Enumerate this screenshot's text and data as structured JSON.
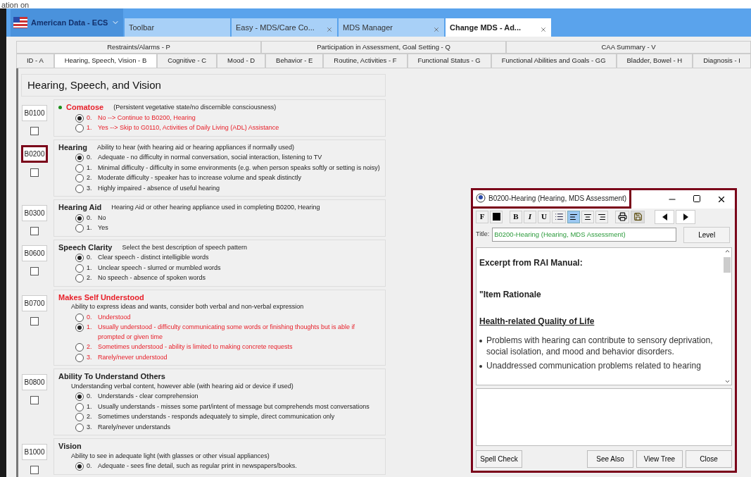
{
  "doc_fragment": "ation on",
  "app": {
    "name": "American Data - ECS"
  },
  "tabs": [
    {
      "label": "Toolbar",
      "closable": false,
      "selected": false
    },
    {
      "label": "Easy - MDS/Care Co...",
      "closable": true,
      "selected": false
    },
    {
      "label": "MDS Manager",
      "closable": true,
      "selected": false
    },
    {
      "label": "Change MDS - Ad...",
      "closable": true,
      "selected": true
    }
  ],
  "section_tabs_top": [
    "Restraints/Alarms - P",
    "Participation in Assessment, Goal Setting - Q",
    "CAA Summary - V"
  ],
  "section_tabs": [
    {
      "label": "ID - A",
      "selected": false
    },
    {
      "label": "Hearing, Speech, Vision - B",
      "selected": true
    },
    {
      "label": "Cognitive - C",
      "selected": false
    },
    {
      "label": "Mood - D",
      "selected": false
    },
    {
      "label": "Behavior - E",
      "selected": false
    },
    {
      "label": "Routine, Activities - F",
      "selected": false
    },
    {
      "label": "Functional Status - G",
      "selected": false
    },
    {
      "label": "Functional Abilities and Goals - GG",
      "selected": false
    },
    {
      "label": "Bladder, Bowel - H",
      "selected": false
    },
    {
      "label": "Diagnosis - I",
      "selected": false
    }
  ],
  "form": {
    "heading": "Hearing, Speech, and Vision",
    "items": [
      {
        "code": "B0100",
        "highlighted": false,
        "checked": false,
        "dot": true,
        "alert": true,
        "kind": "inline",
        "title": "Comatose",
        "description": "(Persistent vegetative state/no discernible consciousness)",
        "options": [
          {
            "number": "0.",
            "label": "No --> Continue to B0200, Hearing",
            "selected": true
          },
          {
            "number": "1.",
            "label": "Yes --> Skip to G0110, Activities of Daily Living (ADL) Assistance",
            "selected": false
          }
        ]
      },
      {
        "code": "B0200",
        "highlighted": true,
        "checked": false,
        "dot": false,
        "alert": false,
        "kind": "inline",
        "title": "Hearing",
        "description": "Ability to hear (with hearing aid or hearing appliances if normally used)",
        "options": [
          {
            "number": "0.",
            "label": "Adequate - no difficulty in normal conversation, social interaction, listening to TV",
            "selected": true
          },
          {
            "number": "1.",
            "label": "Minimal difficulty - difficulty in some environments (e.g. when person speaks softly or setting is noisy)",
            "selected": false
          },
          {
            "number": "2.",
            "label": "Moderate difficulty - speaker has to increase volume and speak distinctly",
            "selected": false
          },
          {
            "number": "3.",
            "label": "Highly impaired - absence of useful hearing",
            "selected": false
          }
        ]
      },
      {
        "code": "B0300",
        "highlighted": false,
        "checked": false,
        "dot": false,
        "alert": false,
        "kind": "inline",
        "title": "Hearing Aid",
        "description": "Hearing Aid or other hearing appliance used in completing B0200, Hearing",
        "options": [
          {
            "number": "0.",
            "label": "No",
            "selected": true
          },
          {
            "number": "1.",
            "label": "Yes",
            "selected": false
          }
        ]
      },
      {
        "code": "B0600",
        "highlighted": false,
        "checked": false,
        "dot": false,
        "alert": false,
        "kind": "inline",
        "title": "Speech Clarity",
        "description": "Select the best description of speech pattern",
        "options": [
          {
            "number": "0.",
            "label": "Clear speech - distinct intelligible words",
            "selected": true
          },
          {
            "number": "1.",
            "label": "Unclear speech - slurred or mumbled words",
            "selected": false
          },
          {
            "number": "2.",
            "label": "No speech - absence of spoken words",
            "selected": false
          }
        ]
      },
      {
        "code": "B0700",
        "highlighted": false,
        "checked": false,
        "dot": false,
        "alert": true,
        "kind": "block",
        "title": "Makes Self Understood",
        "description": "Ability to express ideas and wants, consider both verbal and non-verbal expression",
        "options": [
          {
            "number": "0.",
            "label": "Understood",
            "selected": false
          },
          {
            "number": "1.",
            "label": "Usually understood - difficulty communicating some words or finishing thoughts but is able if prompted or given time",
            "selected": true
          },
          {
            "number": "2.",
            "label": "Sometimes understood - ability is limited to making concrete requests",
            "selected": false
          },
          {
            "number": "3.",
            "label": "Rarely/never understood",
            "selected": false
          }
        ]
      },
      {
        "code": "B0800",
        "highlighted": false,
        "checked": false,
        "dot": false,
        "alert": false,
        "kind": "block",
        "title": "Ability To Understand Others",
        "description": "Understanding verbal content, however able (with hearing aid or device if used)",
        "options": [
          {
            "number": "0.",
            "label": "Understands - clear comprehension",
            "selected": true
          },
          {
            "number": "1.",
            "label": "Usually understands - misses some part/intent of message but comprehends most conversations",
            "selected": false
          },
          {
            "number": "2.",
            "label": "Sometimes understands - responds adequately to simple, direct communication only",
            "selected": false
          },
          {
            "number": "3.",
            "label": "Rarely/never understands",
            "selected": false
          }
        ]
      },
      {
        "code": "B1000",
        "highlighted": false,
        "checked": false,
        "dot": false,
        "alert": false,
        "kind": "block",
        "title": "Vision",
        "description": "Ability to see in adequate light (with glasses or other visual appliances)",
        "options": [
          {
            "number": "0.",
            "label": "Adequate - sees fine detail, such as regular print in newspapers/books.",
            "selected": true
          }
        ]
      }
    ]
  },
  "dialog": {
    "title": "B0200-Hearing (Hearing, MDS Assessment)",
    "toolbar": {
      "font": "F",
      "bold": "B",
      "italic": "I",
      "underline": "U",
      "align_left_selected": true
    },
    "title_label": "Title:",
    "title_value": "B0200-Hearing (Hearing, MDS Assessment)",
    "level_button": "Level",
    "content": {
      "heading": "Excerpt from RAI Manual:",
      "subheading": "\"Item Rationale",
      "section": "Health-related Quality of Life",
      "bullets": [
        "Problems with hearing can contribute to sensory deprivation, social isolation, and mood and behavior disorders.",
        "Unaddressed communication problems related to hearing"
      ]
    },
    "buttons": [
      "Spell Check",
      "See Also",
      "View Tree",
      "Close"
    ]
  }
}
